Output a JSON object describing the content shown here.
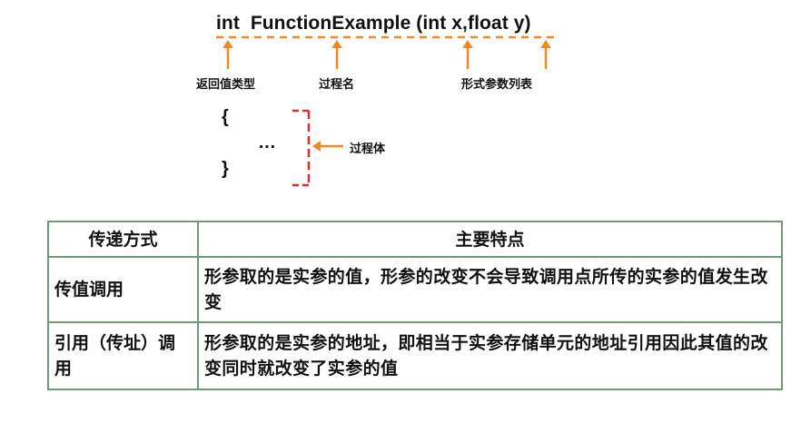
{
  "signature": {
    "text": "int  FunctionExample (int x,float y)"
  },
  "annotations": {
    "return_type": "返回值类型",
    "proc_name": "过程名",
    "param_list": "形式参数列表",
    "proc_body": "过程体"
  },
  "body_code": {
    "open_brace": "{",
    "ellipsis": "…",
    "close_brace": "}"
  },
  "table": {
    "headers": [
      "传递方式",
      "主要特点"
    ],
    "rows": [
      {
        "mode": "传值调用",
        "desc": "形参取的是实参的值，形参的改变不会导致调用点所传的实参的值发生改变"
      },
      {
        "mode": "引用（传址）调用",
        "desc": "形参取的是实参的地址，即相当于实参存储单元的地址引用因此其值的改变同时就改变了实参的值"
      }
    ]
  },
  "colors": {
    "arrow": "#f08a24",
    "bracket": "#d9302b",
    "table_border": "#6f9a78"
  }
}
